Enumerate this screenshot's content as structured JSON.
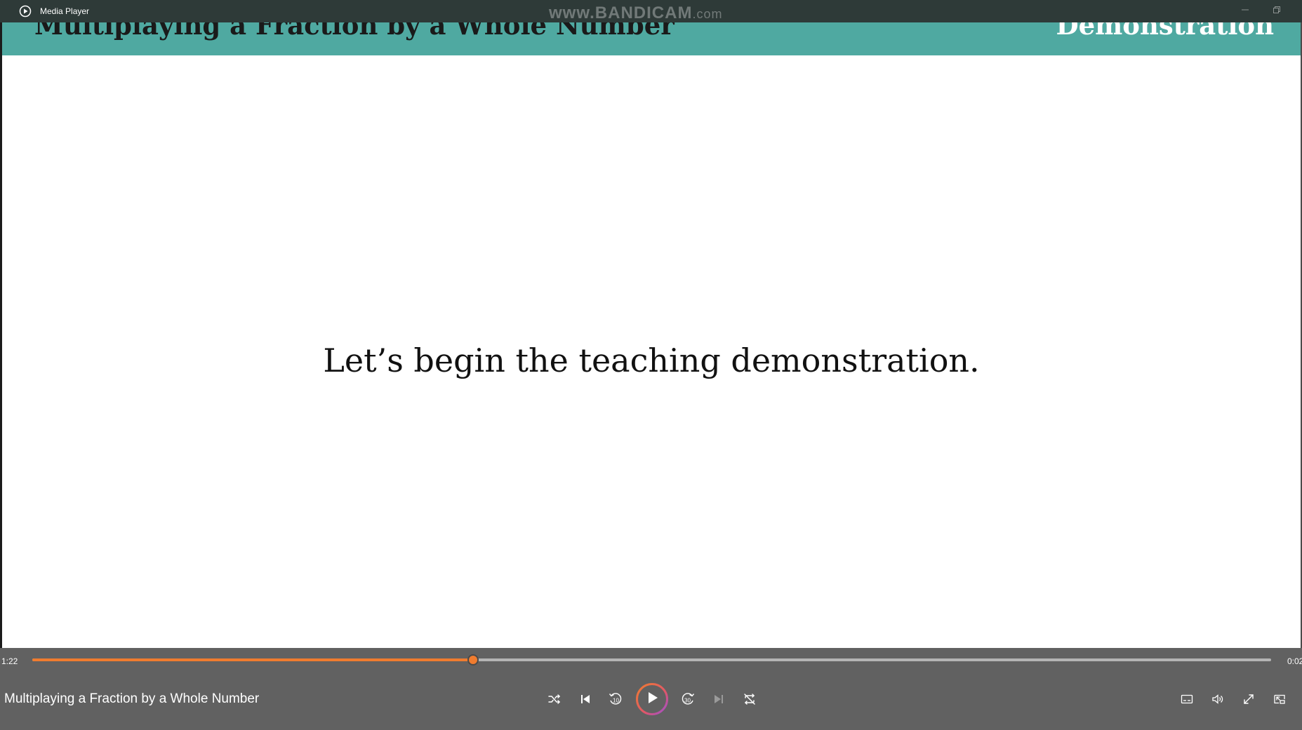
{
  "window": {
    "app_title": "Media Player",
    "watermark_main": "www.BANDICAM",
    "watermark_suffix": ".com"
  },
  "slide": {
    "title": "Multiplaying a Fraction by a Whole Number",
    "section": "Demonstration",
    "message": "Let’s begin the teaching demonstration.",
    "header_color": "#4fa9a1"
  },
  "player": {
    "elapsed": "1:22",
    "remaining": "0:02",
    "progress_fraction": 0.356,
    "now_playing_title": "Multiplaying a Fraction by a Whole Number",
    "accent_color": "#f07c2f",
    "buttons": {
      "shuffle": "shuffle-icon",
      "previous": "previous-icon",
      "rewind": "rewind-10-icon",
      "rewind_label": "10",
      "play": "play-icon",
      "forward": "forward-30-icon",
      "forward_label": "30",
      "next": "next-icon",
      "repeat": "repeat-off-icon",
      "captions": "captions-icon",
      "volume": "volume-icon",
      "fullscreen": "fullscreen-icon",
      "miniplayer": "miniplayer-icon"
    }
  }
}
